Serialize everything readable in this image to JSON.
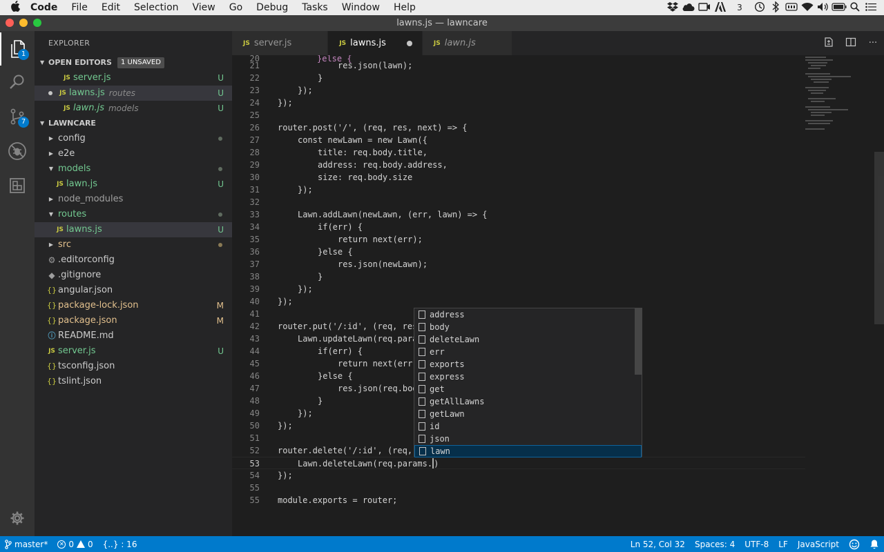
{
  "menubar": {
    "apple_icon": "apple-icon",
    "app_name": "Code",
    "items": [
      "File",
      "Edit",
      "Selection",
      "View",
      "Go",
      "Debug",
      "Tasks",
      "Window",
      "Help"
    ],
    "tray": [
      "dropbox-icon",
      "cloud-icon",
      "video-icon",
      "adobe-icon",
      "3",
      "time-machine-icon",
      "bluetooth-icon",
      "battery-meter-icon",
      "wifi-icon",
      "volume-icon",
      "battery-icon",
      "search-icon",
      "list-icon"
    ]
  },
  "window": {
    "title": "lawns.js — lawncare"
  },
  "activity": {
    "explorer_badge": "1",
    "scm_badge": "7"
  },
  "sidebar": {
    "title": "EXPLORER",
    "open_editors": {
      "label": "OPEN EDITORS",
      "unsaved_label": "1 UNSAVED",
      "items": [
        {
          "name": "server.js",
          "desc": "",
          "deco": "U"
        },
        {
          "name": "lawns.js",
          "desc": "routes",
          "deco": "U"
        },
        {
          "name": "lawn.js",
          "desc": "models",
          "deco": "U"
        }
      ]
    },
    "project": {
      "label": "LAWNCARE",
      "items": [
        {
          "name": "config",
          "deco": ""
        },
        {
          "name": "e2e",
          "deco": ""
        },
        {
          "name": "models",
          "deco": ""
        },
        {
          "name": "lawn.js",
          "deco": "U"
        },
        {
          "name": "node_modules",
          "deco": ""
        },
        {
          "name": "routes",
          "deco": ""
        },
        {
          "name": "lawns.js",
          "deco": "U"
        },
        {
          "name": "src",
          "deco": ""
        },
        {
          "name": ".editorconfig",
          "deco": ""
        },
        {
          "name": ".gitignore",
          "deco": ""
        },
        {
          "name": "angular.json",
          "deco": ""
        },
        {
          "name": "package-lock.json",
          "deco": "M"
        },
        {
          "name": "package.json",
          "deco": "M"
        },
        {
          "name": "README.md",
          "deco": ""
        },
        {
          "name": "server.js",
          "deco": "U"
        },
        {
          "name": "tsconfig.json",
          "deco": ""
        },
        {
          "name": "tslint.json",
          "deco": ""
        }
      ]
    }
  },
  "tabs": [
    {
      "label": "server.js",
      "icon": "JS"
    },
    {
      "label": "lawns.js",
      "icon": "JS"
    },
    {
      "label": "lawn.js",
      "icon": "JS"
    }
  ],
  "editor": {
    "line_numbers": [
      "20",
      "21",
      "22",
      "23",
      "24",
      "25",
      "26",
      "27",
      "28",
      "29",
      "30",
      "31",
      "32",
      "33",
      "34",
      "35",
      "36",
      "37",
      "38",
      "39",
      "40",
      "41",
      "42",
      "43",
      "44",
      "45",
      "46",
      "47",
      "48",
      "49",
      "50",
      "51",
      "52",
      "53",
      "54",
      "55"
    ],
    "code": {
      "l20_kw": "}else {",
      "l21": "res.json(lawn);",
      "l22": "}",
      "l23": "});",
      "l24": "});",
      "l26": "router.post('/', (req, res, next) => {",
      "l27": "const newLawn = new Lawn({",
      "l28": "title: req.body.title,",
      "l29": "address: req.body.address,",
      "l30": "size: req.body.size",
      "l31": "});",
      "l33": "Lawn.addLawn(newLawn, (err, lawn) => {",
      "l34": "if(err) {",
      "l35": "return next(err);",
      "l36": "}else {",
      "l37": "res.json(newLawn);",
      "l38": "}",
      "l39": "});",
      "l40": "});",
      "l42": "router.put('/:id', (req, res",
      "l43": "Lawn.updateLawn(req.para",
      "l44": "if(err) {",
      "l45": "return next(err)",
      "l46": "}else {",
      "l47": "res.json(req.bod",
      "l48": "}",
      "l49": "});",
      "l50": "});",
      "l52": "router.delete('/:id', (req,",
      "l53": "Lawn.deleteLawn(req.params.",
      "l53b": ")",
      "l54": "});",
      "l56": "module.exports = router;"
    }
  },
  "suggest": {
    "items": [
      "address",
      "body",
      "deleteLawn",
      "err",
      "exports",
      "express",
      "get",
      "getAllLawns",
      "getLawn",
      "id",
      "json",
      "lawn"
    ],
    "focused": "lawn"
  },
  "status": {
    "branch": "master*",
    "errors": "0",
    "warnings": "0",
    "breadcrumb": "{..} : 16",
    "position": "Ln 52, Col 32",
    "spaces": "Spaces: 4",
    "encoding": "UTF-8",
    "eol": "LF",
    "language": "JavaScript"
  },
  "colors": {
    "accent": "#007acc",
    "git_untracked": "#73c991",
    "git_modified": "#e2c08d",
    "js_icon": "#cbcb41"
  }
}
